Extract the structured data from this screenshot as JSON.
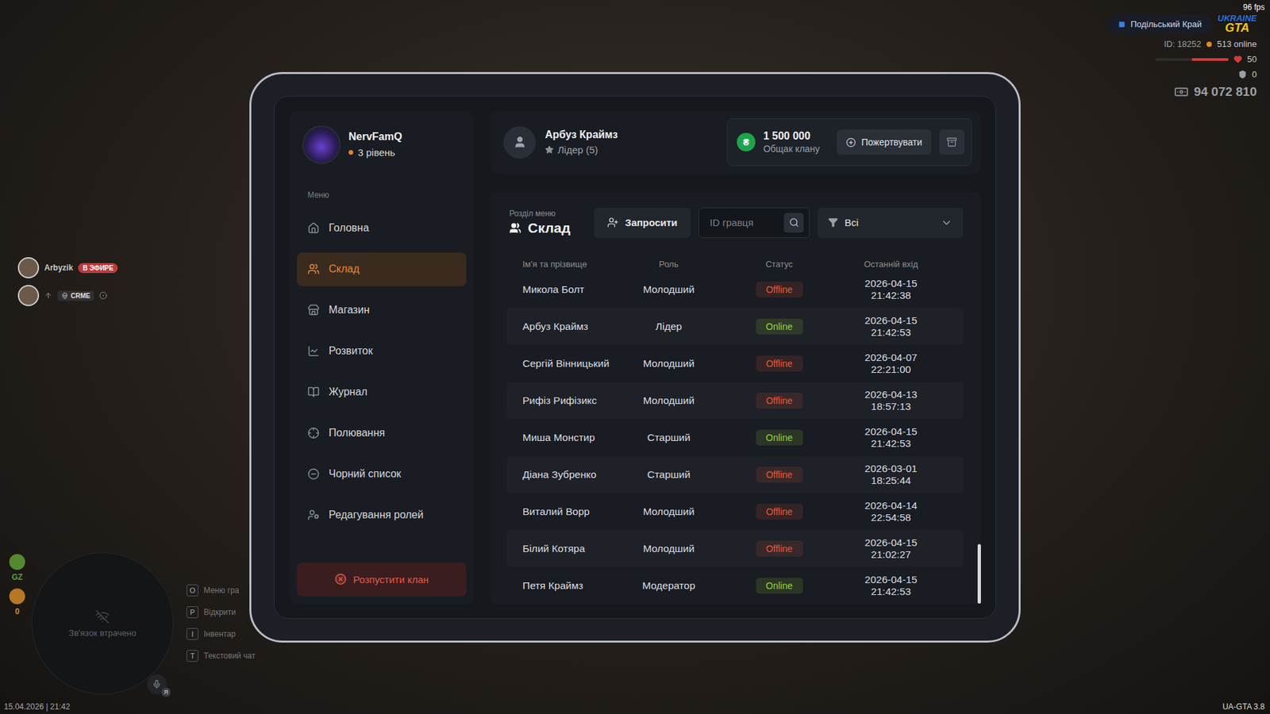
{
  "hud": {
    "fps": "96 fps",
    "region": "Подільський Край",
    "logo": {
      "top": "UKRAINE",
      "bottom": "GTA"
    },
    "player_id": "ID: 18252",
    "online": "513 online",
    "health": {
      "value": "50",
      "level": 0.5
    },
    "armor": {
      "value": "0"
    },
    "money": "94 072 810",
    "players": [
      {
        "name": "Arbyzik",
        "badge": "В ЭФИРЕ"
      },
      {
        "tag": "CRME"
      }
    ],
    "indicators": [
      {
        "label": "GZ",
        "color": "#5f9e35"
      },
      {
        "label": "0",
        "color": "#d08a2a"
      }
    ],
    "minimap": {
      "status": "Зв'язок втрачено",
      "voice_badge": "Я"
    },
    "hints": [
      {
        "key": "O",
        "label": "Меню гра"
      },
      {
        "key": "P",
        "label": "Відкрити"
      },
      {
        "key": "I",
        "label": "Інвентар"
      },
      {
        "key": "T",
        "label": "Текстовий чат"
      }
    ],
    "datetime": "15.04.2026 | 21:42",
    "version": "UA-GTA 3.8"
  },
  "clan": {
    "name": "NervFamQ",
    "level": "3 рівень"
  },
  "sidebar": {
    "heading": "Меню",
    "items": [
      {
        "label": "Головна",
        "selected": false
      },
      {
        "label": "Склад",
        "selected": true
      },
      {
        "label": "Магазин",
        "selected": false
      },
      {
        "label": "Розвиток",
        "selected": false
      },
      {
        "label": "Журнал",
        "selected": false
      },
      {
        "label": "Полювання",
        "selected": false
      },
      {
        "label": "Чорний список",
        "selected": false
      },
      {
        "label": "Редагування ролей",
        "selected": false
      }
    ],
    "dissolve": "Розпустити клан"
  },
  "member": {
    "name": "Арбуз Краймз",
    "role": "Лідер (5)"
  },
  "bank": {
    "currency": "₴",
    "amount": "1 500 000",
    "label": "Общак клану",
    "donate": "Пожертвувати"
  },
  "section": {
    "caption": "Розділ меню",
    "title": "Склад",
    "invite": "Запросити",
    "search_placeholder": "ID гравця",
    "filter": "Всі"
  },
  "table": {
    "columns": [
      "Ім'я та прізвище",
      "Роль",
      "Статус",
      "Останній вхід"
    ],
    "rows": [
      {
        "name": "Микола Болт",
        "role": "Молодший",
        "status": "Offline",
        "color": "#e5573b",
        "last_seen": "2026-04-15 21:42:38"
      },
      {
        "name": "Арбуз Краймз",
        "role": "Лідер",
        "status": "Online",
        "color": "#9bd13b",
        "last_seen": "2026-04-15 21:42:53"
      },
      {
        "name": "Сергій Вінницький",
        "role": "Молодший",
        "status": "Offline",
        "color": "#e5573b",
        "last_seen": "2026-04-07 22:21:00"
      },
      {
        "name": "Рифіз Рифізикс",
        "role": "Молодший",
        "status": "Offline",
        "color": "#e5573b",
        "last_seen": "2026-04-13 18:57:13"
      },
      {
        "name": "Миша Монстир",
        "role": "Старший",
        "status": "Online",
        "color": "#9bd13b",
        "last_seen": "2026-04-15 21:42:53"
      },
      {
        "name": "Діана Зубренко",
        "role": "Старший",
        "status": "Offline",
        "color": "#e5573b",
        "last_seen": "2026-03-01 18:25:44"
      },
      {
        "name": "Виталий Ворр",
        "role": "Молодший",
        "status": "Offline",
        "color": "#e5573b",
        "last_seen": "2026-04-14 22:54:58"
      },
      {
        "name": "Білий Котяра",
        "role": "Молодший",
        "status": "Offline",
        "color": "#e5573b",
        "last_seen": "2026-04-15 21:02:27"
      },
      {
        "name": "Петя Краймз",
        "role": "Модератор",
        "status": "Online",
        "color": "#9bd13b",
        "last_seen": "2026-04-15 21:42:53"
      }
    ],
    "scroll": {
      "level": 1,
      "thumb": 0.18
    }
  }
}
